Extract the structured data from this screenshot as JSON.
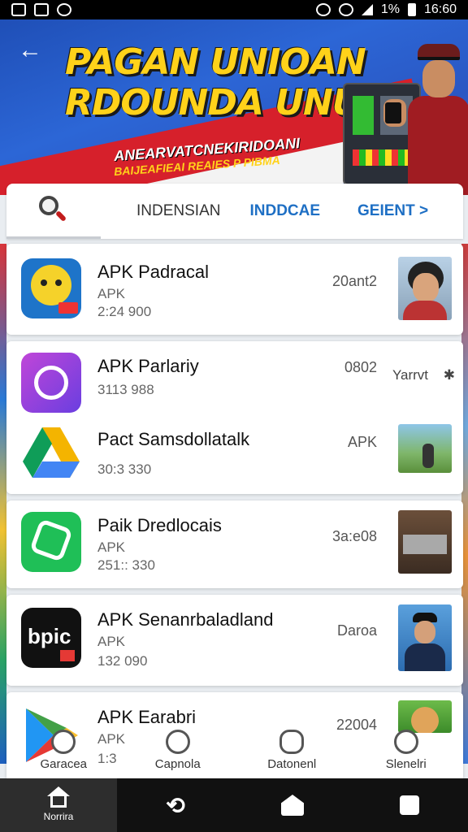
{
  "status_bar": {
    "battery": "1%",
    "time": "16:60"
  },
  "banner": {
    "title": "PAGAN UNIOAN RDOUNDA UNU",
    "subtitle_1": "ANEARVATCNEKIRIDOANI",
    "subtitle_2": "BAIJEAFIEAI REAIES P PIBMA"
  },
  "tabs": [
    {
      "label": "INDENSIAN"
    },
    {
      "label": "INDDCAE"
    },
    {
      "label": "GEIENT >"
    }
  ],
  "apps": [
    {
      "name": "APK Padracal",
      "type": "APK",
      "size": "2:24 900",
      "meta": "20ant2"
    },
    {
      "name": "APK Parlariy",
      "type": "",
      "size": "3113 988",
      "meta": "0802",
      "meta2": "Yarrvt"
    },
    {
      "name": "Pact Samsdollatalk",
      "type": "",
      "size": "30:3 330",
      "meta": "APK"
    },
    {
      "name": "Paik Dredlocais",
      "type": "APK",
      "size": "251:: 330",
      "meta": "3a:e08"
    },
    {
      "name": "APK Senanrbaladland",
      "type": "APK",
      "size": "132 090",
      "meta": "Daroa",
      "icon_text": "bpic"
    },
    {
      "name": "APK Earabri",
      "type": "APK",
      "size": "1:3",
      "meta": "22004"
    }
  ],
  "inner_nav": [
    {
      "label": "Garacea",
      "icon": "person-icon"
    },
    {
      "label": "Capnola",
      "icon": "shield-icon"
    },
    {
      "label": "Datonenl",
      "icon": "people-icon"
    },
    {
      "label": "Slenelri",
      "icon": "user-icon"
    }
  ],
  "system_nav": {
    "home_label": "Norrira"
  },
  "colors": {
    "accent_blue": "#1e6fc4",
    "banner_yellow": "#ffd21a",
    "flag_red": "#d6202b"
  }
}
